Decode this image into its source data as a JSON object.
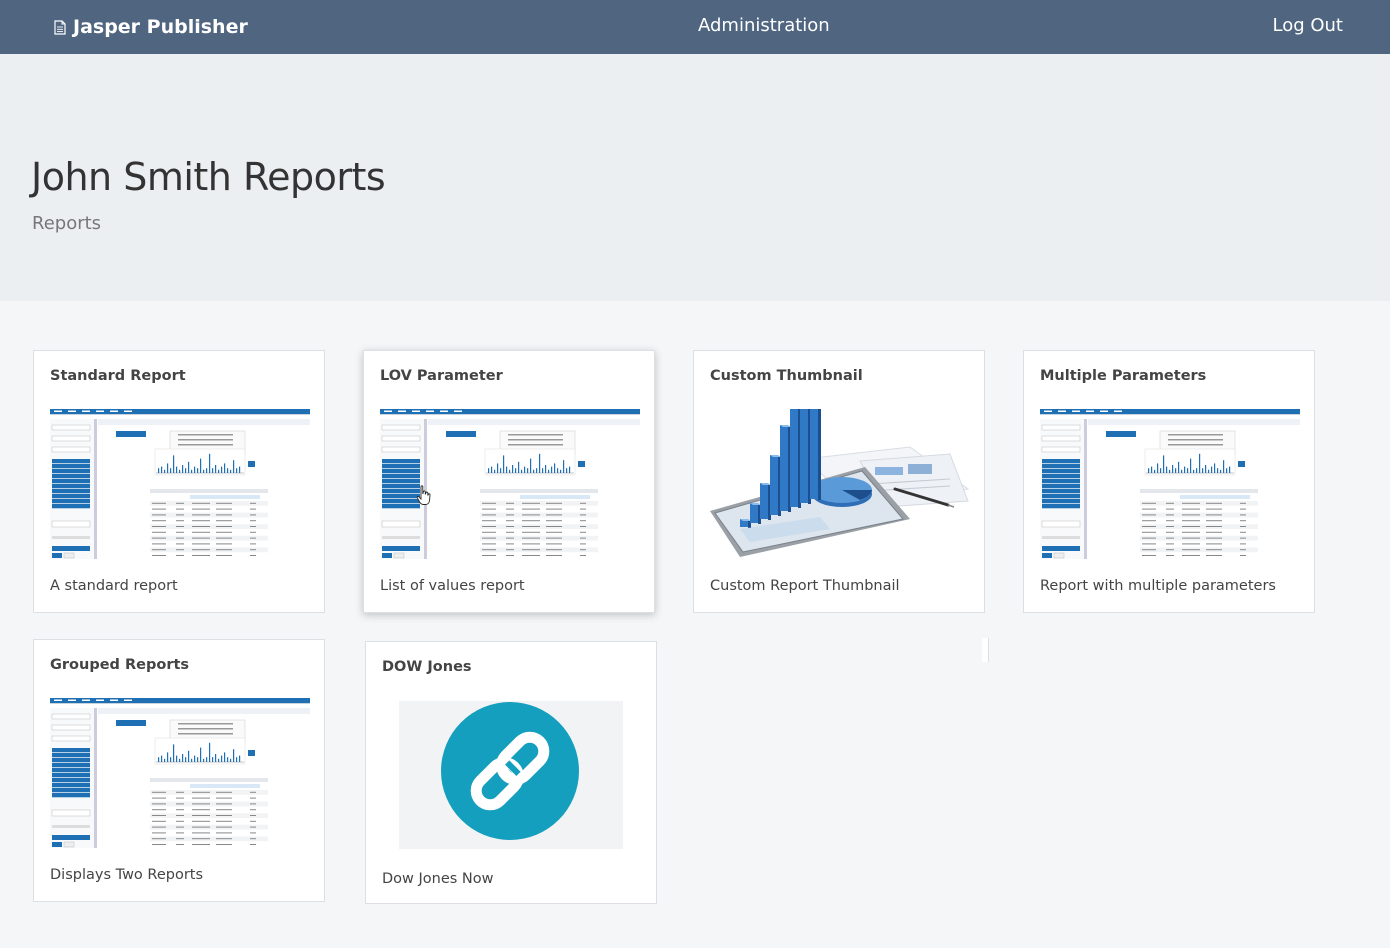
{
  "navbar": {
    "brand": "Jasper Publisher",
    "brand_icon": "document-icon",
    "admin_label": "Administration",
    "logout_label": "Log Out",
    "background": "#4f6580"
  },
  "header": {
    "title": "John Smith Reports",
    "subtitle": "Reports"
  },
  "reports": [
    {
      "title": "Standard Report",
      "description": "A standard report",
      "thumbnail": "report-screenshot"
    },
    {
      "title": "LOV Parameter",
      "description": "List of values report",
      "thumbnail": "report-screenshot"
    },
    {
      "title": "Custom Thumbnail",
      "description": "Custom Report Thumbnail",
      "thumbnail": "3d-bar-chart-tablet"
    },
    {
      "title": "Multiple Parameters",
      "description": "Report with multiple parameters",
      "thumbnail": "report-screenshot"
    },
    {
      "title": "Grouped Reports",
      "description": "Displays Two Reports",
      "thumbnail": "report-screenshot"
    },
    {
      "title": "DOW Jones",
      "description": "Dow Jones Now",
      "thumbnail": "link-icon"
    }
  ],
  "colors": {
    "accent_blue": "#1f6fb5",
    "link_circle": "#139fbd"
  }
}
